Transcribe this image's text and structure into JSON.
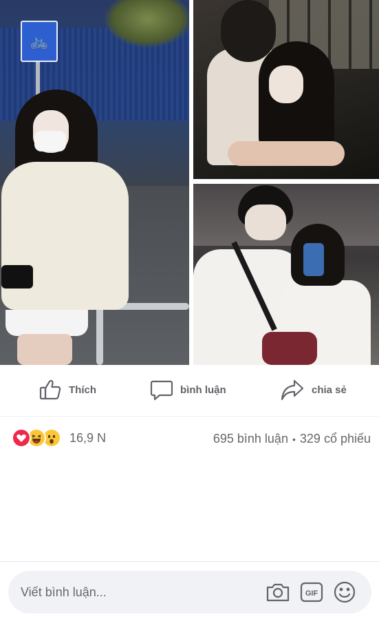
{
  "actions": {
    "like_label": "Thích",
    "comment_label": "bình luận",
    "share_label": "chia sẻ",
    "like_icon": "thumbs-up-icon",
    "comment_icon": "speech-bubble-icon",
    "share_icon": "share-arrow-icon"
  },
  "reactions": {
    "icons": [
      "love-reaction-icon",
      "haha-reaction-icon",
      "wow-reaction-icon"
    ],
    "count": "16,9 N",
    "comments_count": "695",
    "comments_label": "bình luận",
    "separator": "•",
    "shares_count": "329",
    "shares_label": "cổ phiếu"
  },
  "composer": {
    "placeholder": "Viết bình luận...",
    "icons": [
      "camera-icon",
      "gif-icon",
      "smiley-icon"
    ]
  },
  "colors": {
    "text_secondary": "#65676b",
    "composer_bg": "#f0f2f5",
    "love": "#f0284a",
    "haha": "#fcc63b"
  }
}
